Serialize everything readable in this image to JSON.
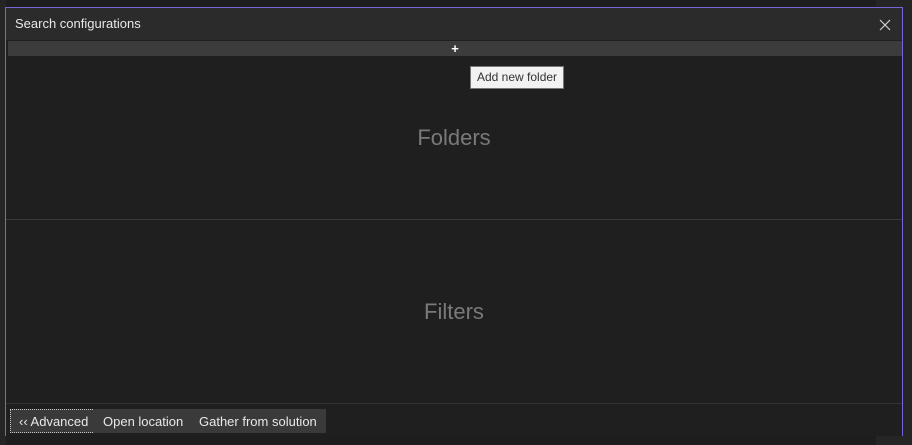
{
  "dialog": {
    "title": "Search configurations"
  },
  "toolbar": {
    "add_glyph": "+",
    "add_tooltip": "Add new folder"
  },
  "sections": {
    "folders_label": "Folders",
    "filters_label": "Filters"
  },
  "footer": {
    "advanced_label": "‹‹ Advanced",
    "open_location_label": "Open location",
    "gather_label": "Gather from solution"
  },
  "colors": {
    "accent_border": "#7b63d6",
    "background": "#1f1f1f"
  },
  "icons": {
    "close": "close-icon",
    "add": "plus-icon"
  }
}
